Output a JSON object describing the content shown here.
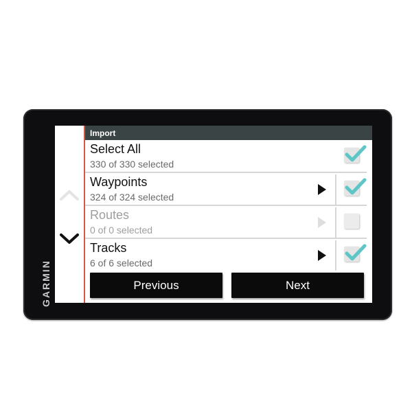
{
  "device": {
    "brand": "GARMIN"
  },
  "header": {
    "title": "Import"
  },
  "rows": [
    {
      "label": "Select All",
      "sub": "330 of 330 selected",
      "checked": true,
      "has_arrow": false,
      "disabled": false
    },
    {
      "label": "Waypoints",
      "sub": "324 of 324 selected",
      "checked": true,
      "has_arrow": true,
      "disabled": false
    },
    {
      "label": "Routes",
      "sub": "0 of 0 selected",
      "checked": false,
      "has_arrow": true,
      "disabled": true
    },
    {
      "label": "Tracks",
      "sub": "6 of 6 selected",
      "checked": true,
      "has_arrow": true,
      "disabled": false
    }
  ],
  "footer": {
    "previous_label": "Previous",
    "next_label": "Next"
  },
  "colors": {
    "check": "#5ec6c6",
    "header_bg": "#3b4444",
    "rail_border": "#d9544d",
    "button_bg": "#0b0b0c"
  },
  "icons": {
    "scroll_up": "chevron-up-icon",
    "scroll_down": "chevron-down-icon",
    "row_arrow": "play-arrow-icon",
    "check": "checkmark-icon"
  }
}
